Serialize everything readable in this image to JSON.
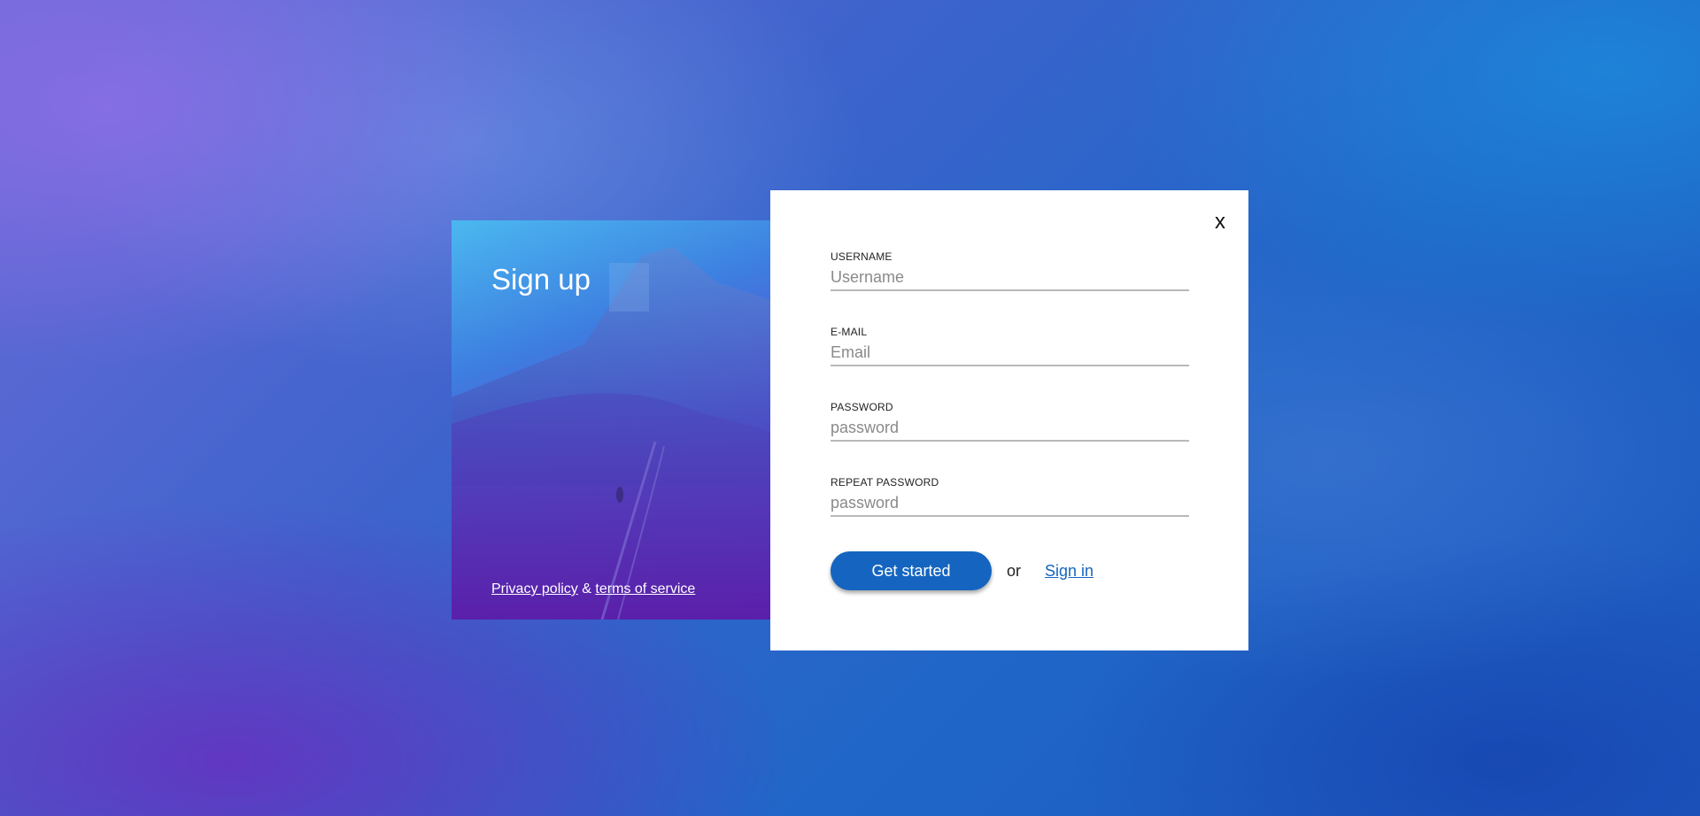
{
  "left_panel": {
    "title": "Sign up",
    "privacy_link": "Privacy policy",
    "amp": "&",
    "terms_link": "terms of service"
  },
  "form": {
    "close_label": "x",
    "fields": [
      {
        "label": "USERNAME",
        "placeholder": "Username",
        "value": ""
      },
      {
        "label": "E-MAIL",
        "placeholder": "Email",
        "value": ""
      },
      {
        "label": "PASSWORD",
        "placeholder": "password",
        "value": ""
      },
      {
        "label": "REPEAT PASSWORD",
        "placeholder": "password",
        "value": ""
      }
    ],
    "submit_label": "Get started",
    "or_text": "or",
    "signin_label": "Sign in"
  },
  "colors": {
    "accent": "#1565c0",
    "card_bg": "#ffffff"
  }
}
